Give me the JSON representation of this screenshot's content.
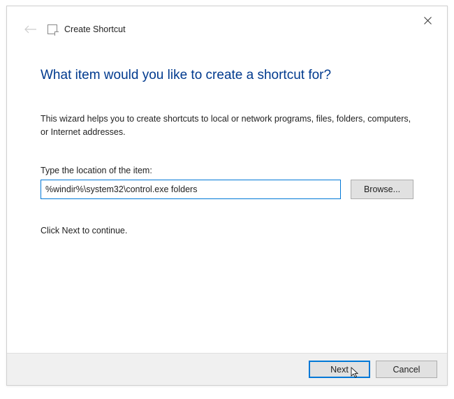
{
  "window": {
    "title": "Create Shortcut"
  },
  "content": {
    "heading": "What item would you like to create a shortcut for?",
    "description": "This wizard helps you to create shortcuts to local or network programs, files, folders, computers, or Internet addresses.",
    "location_label": "Type the location of the item:",
    "location_value": "%windir%\\system32\\control.exe folders",
    "browse_label": "Browse...",
    "continue_text": "Click Next to continue."
  },
  "footer": {
    "next_label": "Next",
    "cancel_label": "Cancel"
  }
}
